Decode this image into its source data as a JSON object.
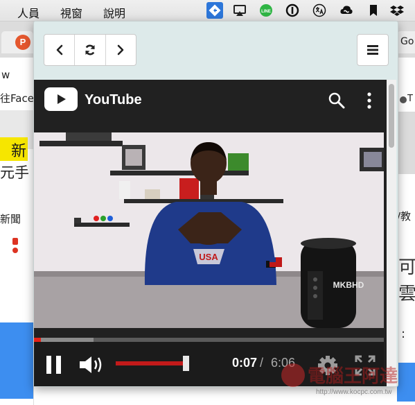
{
  "menubar": {
    "items": [
      {
        "label": "人員"
      },
      {
        "label": "視窗"
      },
      {
        "label": "說明"
      }
    ],
    "tray_icons": [
      "diamond-app-icon",
      "airplay-icon",
      "line-icon",
      "1password-icon",
      "translate-icon",
      "creative-cloud-icon",
      "bookmark-icon",
      "dropbox-icon"
    ],
    "line_label": "LINE"
  },
  "background_browser": {
    "fragments": {
      "tab_partial": "Go",
      "left_w": "w",
      "left_face": "往Face",
      "left_news1": "新",
      "left_news2": "元手",
      "left_xinwen": "新聞",
      "right_edu": "/教",
      "right_t": "T",
      "right_ke": "可",
      "right_yun": "雲",
      "right_colon": ":"
    }
  },
  "popup": {
    "nav": {
      "back_icon": "chevron-left-icon",
      "reload_icon": "refresh-icon",
      "forward_icon": "chevron-right-icon",
      "menu_icon": "hamburger-menu-icon"
    },
    "youtube": {
      "title": "YouTube",
      "search_icon": "search-icon",
      "more_icon": "more-vert-icon",
      "video": {
        "shirt_text": "USA",
        "channel_watermark": "MKBHD"
      },
      "player": {
        "progress_played": 0.02,
        "progress_buffered": 0.17,
        "volume_level": 0.95,
        "current_time": "0:07",
        "separator": "/",
        "duration": "6:06",
        "pause_icon": "pause-icon",
        "volume_icon": "volume-icon",
        "settings_icon": "gear-icon",
        "fullscreen_icon": "fullscreen-icon"
      }
    }
  },
  "watermark": {
    "brand": "電腦王阿達",
    "url": "http://www.kocpc.com.tw"
  },
  "colors": {
    "youtube_red": "#e62117",
    "youtube_bg": "#212121",
    "popup_bg": "#ddeaea",
    "tray_active": "#2d76d9"
  }
}
